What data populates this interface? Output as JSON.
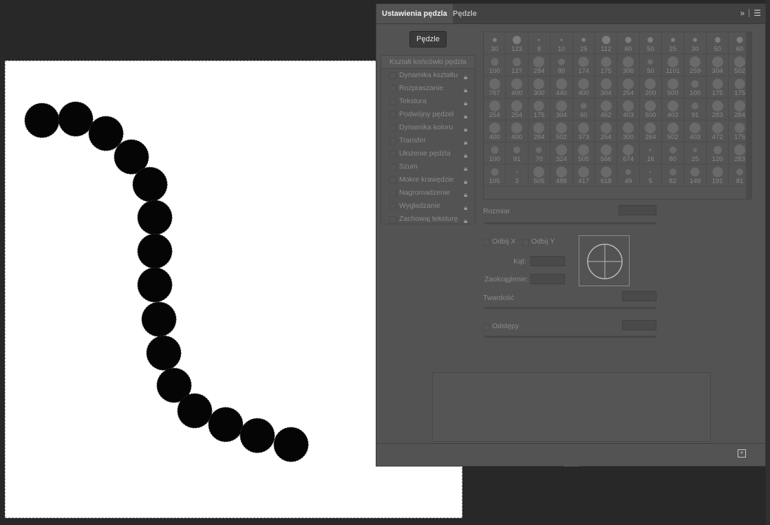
{
  "panel": {
    "tab_active": "Ustawienia pędzla",
    "tab_inactive": "Pędzle",
    "collapse_icon": "double-chevron-right-icon",
    "menu_icon": "hamburger-menu-icon",
    "brushes_button": "Pędzle",
    "section_header": "Kształt końcówki pędzla",
    "options": [
      {
        "label": "Dynamika kształtu"
      },
      {
        "label": "Rozpraszanie"
      },
      {
        "label": "Tekstura"
      },
      {
        "label": "Podwójny pędzel"
      },
      {
        "label": "Dynamika koloru"
      },
      {
        "label": "Transfer"
      },
      {
        "label": "Ułożenie pędzla"
      },
      {
        "label": "Szum"
      },
      {
        "label": "Mokre krawędzie"
      },
      {
        "label": "Nagromadzenie"
      },
      {
        "label": "Wygładzanie"
      },
      {
        "label": "Zachowaj teksturę"
      }
    ],
    "brush_sizes": [
      "30",
      "123",
      "8",
      "10",
      "25",
      "112",
      "60",
      "50",
      "25",
      "30",
      "50",
      "60",
      "100",
      "127",
      "284",
      "80",
      "174",
      "175",
      "306",
      "50",
      "1101",
      "259",
      "304",
      "502",
      "767",
      "400",
      "300",
      "440",
      "400",
      "304",
      "254",
      "200",
      "500",
      "100",
      "175",
      "175",
      "254",
      "254",
      "175",
      "304",
      "60",
      "462",
      "403",
      "500",
      "403",
      "91",
      "283",
      "284",
      "400",
      "400",
      "284",
      "502",
      "373",
      "254",
      "300",
      "264",
      "502",
      "403",
      "472",
      "175",
      "100",
      "91",
      "70",
      "324",
      "505",
      "566",
      "674",
      "16",
      "80",
      "25",
      "120",
      "283",
      "105",
      "3",
      "505",
      "488",
      "417",
      "618",
      "49",
      "5",
      "82",
      "149",
      "191",
      "81"
    ],
    "size_label": "Rozmiar",
    "flip_x": "Odbij X",
    "flip_y": "Odbij Y",
    "angle_label": "Kąt:",
    "roundness_label": "Zaokrąglenie:",
    "hardness_label": "Twardość",
    "spacing_label": "Odstępy",
    "new_brush_icon": "new-brush-plus-icon"
  }
}
